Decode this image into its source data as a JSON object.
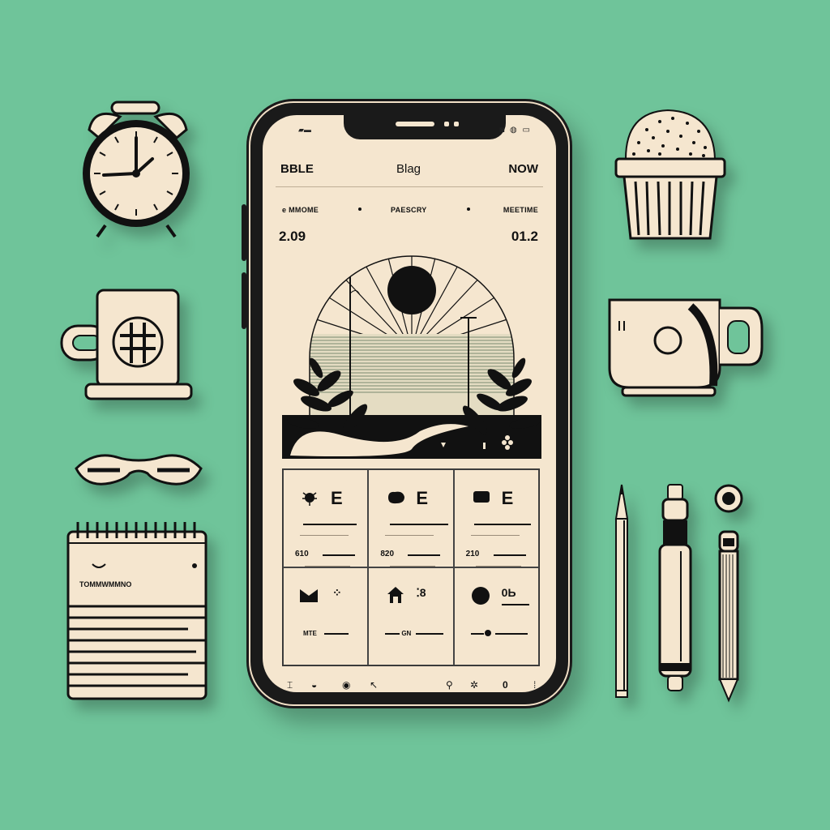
{
  "colors": {
    "background": "#6fc49a",
    "cream": "#f5e6cf",
    "ink": "#111111"
  },
  "phone": {
    "status": {
      "left_glyph": "▰▬",
      "right_icons": "◙ ◍ ▭"
    },
    "header": {
      "left": "BBLE",
      "title": "Blag",
      "right": "NOW"
    },
    "subheader": {
      "left": "e  MMOME",
      "center": "PAESCRY",
      "right": "MEETIME"
    },
    "stats": {
      "left": "2.09",
      "right": "01.2"
    },
    "grid": {
      "row1": [
        {
          "icon": "bug-icon",
          "letter": "E",
          "value": "610"
        },
        {
          "icon": "blob-icon",
          "letter": "E",
          "value": "820"
        },
        {
          "icon": "square-icon",
          "letter": "E",
          "value": "210"
        }
      ],
      "row2": [
        {
          "icon": "mail-icon",
          "glyph": "⁘",
          "label": "MTE"
        },
        {
          "icon": "house-icon",
          "glyph": "⁚8",
          "label": "GN"
        },
        {
          "icon": "circle-icon",
          "glyph": "0Ь",
          "label": ""
        }
      ]
    },
    "tabbar": [
      "⌶",
      "◒",
      "◉",
      "↖",
      "⚲",
      "✲",
      "0",
      "⁞"
    ]
  },
  "props": {
    "notepad": {
      "title": "TOMMWMMNO"
    },
    "clock": {
      "hour": 9,
      "minute": 5
    }
  },
  "icons": [
    "alarm-clock-icon",
    "mug-icon",
    "glasses-icon",
    "notepad-icon",
    "cactus-icon",
    "cup-icon",
    "pencil-icon",
    "marker-icon",
    "pen-icon",
    "button-icon"
  ]
}
